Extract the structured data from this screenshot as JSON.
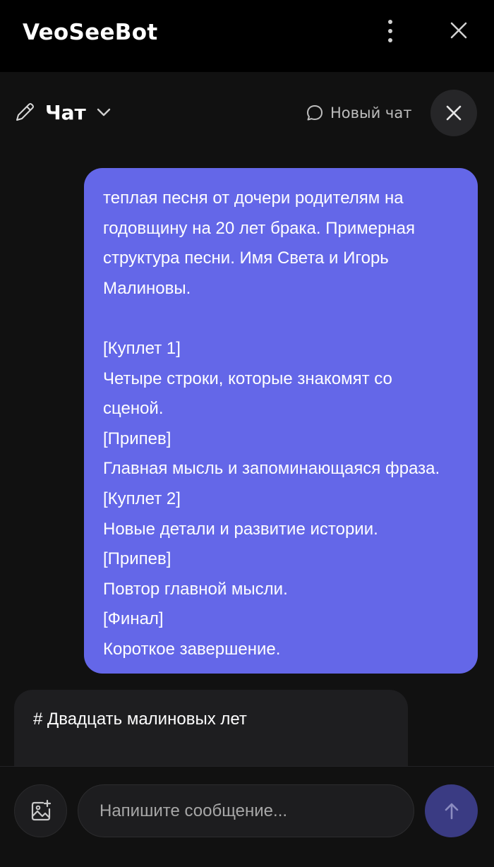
{
  "app": {
    "title": "VeoSeeBot"
  },
  "toolbar": {
    "chat_label": "Чат",
    "new_chat_label": "Новый чат"
  },
  "messages": {
    "user_lines": [
      "теплая песня от дочери родителям на",
      "годовщину на 20 лет брака. Примерная",
      "структура песни. Имя Света и Игорь",
      "Малиновы.",
      "",
      "[Куплет 1]",
      "Четыре строки, которые знакомят со",
      "сценой.",
      "[Припев]",
      "Главная мысль и запоминающаяся фраза.",
      "[Куплет 2]",
      "Новые детали и развитие истории.",
      "[Припев]",
      "Повтор главной мысли.",
      "[Финал]",
      "Короткое завершение."
    ],
    "bot_text": "# Двадцать малиновых лет"
  },
  "composer": {
    "placeholder": "Напишите сообщение..."
  },
  "icons": {
    "menu": "kebab-menu-icon",
    "close": "close-icon",
    "edit": "pencil-icon",
    "dropdown": "chevron-down-icon",
    "new_chat": "chat-bubble-icon",
    "attach": "add-image-icon",
    "send": "arrow-up-icon"
  },
  "colors": {
    "background": "#111111",
    "titlebar": "#000000",
    "user_bubble": "#6467e8",
    "bot_bubble": "#1e1e20",
    "send_button": "#3a3b83"
  }
}
